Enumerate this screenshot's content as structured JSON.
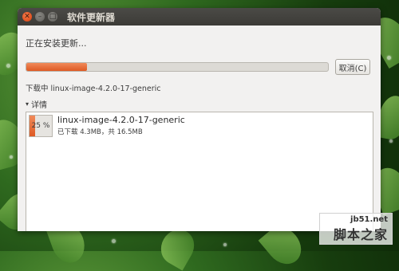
{
  "window": {
    "title": "软件更新器"
  },
  "status": {
    "installing_text": "正在安装更新...",
    "downloading_text": "下载中 linux-image-4.2.0-17-generic",
    "progress": 0.2
  },
  "actions": {
    "cancel_label": "取消(C)"
  },
  "details": {
    "toggle_label": "详情",
    "item": {
      "percent_label": "25 %",
      "percent": 0.25,
      "name": "linux-image-4.2.0-17-generic",
      "sub": "已下载 4.3MB，共 16.5MB"
    }
  },
  "watermark": {
    "domain": "jb51.net",
    "name": "脚本之家"
  },
  "colors": {
    "accent": "#de5a24",
    "titlebar": "#3c3b37",
    "window_bg": "#f2f1f0"
  }
}
